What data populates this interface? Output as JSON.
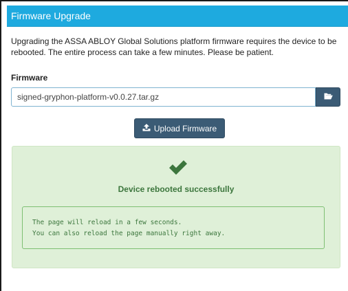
{
  "panel": {
    "title": "Firmware Upgrade",
    "description": "Upgrading the ASSA ABLOY Global Solutions platform firmware requires the device to be rebooted. The entire process can take a few minutes. Please be patient."
  },
  "firmware": {
    "label": "Firmware",
    "value": "signed-gryphon-platform-v0.0.27.tar.gz",
    "browse_icon": "folder-open-icon"
  },
  "upload_button": {
    "label": "Upload Firmware",
    "icon": "upload-icon"
  },
  "status": {
    "icon": "checkmark-icon",
    "title": "Device rebooted successfully",
    "message_line1": "The page will reload in a few seconds.",
    "message_line2": "You can also reload the page manually right away.",
    "color": "#3c763d",
    "background": "#dff0d8"
  },
  "colors": {
    "header": "#1eaadf",
    "button": "#3b5b75"
  }
}
